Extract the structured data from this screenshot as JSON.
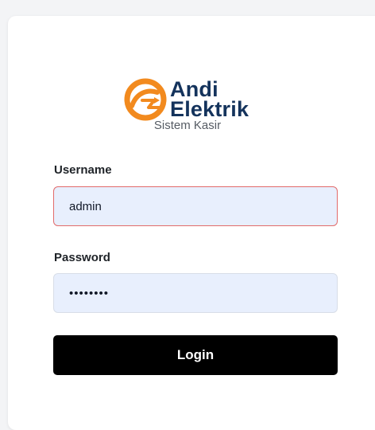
{
  "brand": {
    "name_line1": "Andi",
    "name_line2": "Elektrik",
    "logo_icon": "lightning-plug-logo-icon",
    "logo_color": "#f28a1e",
    "text_color": "#14335c"
  },
  "subtitle": "Sistem Kasir",
  "form": {
    "username_label": "Username",
    "username_value": "admin",
    "password_label": "Password",
    "password_value": "••••••••",
    "login_label": "Login"
  },
  "colors": {
    "input_background": "#e8effd",
    "invalid_border": "#e26b6b",
    "button_background": "#000000"
  }
}
